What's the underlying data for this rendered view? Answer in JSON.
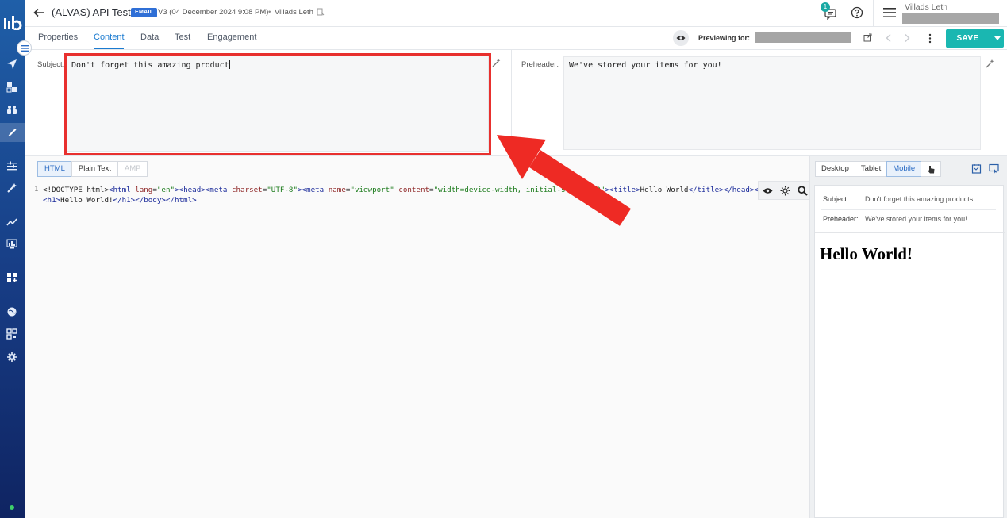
{
  "header": {
    "title": "(ALVAS) API Test",
    "badge": "EMAIL",
    "version": "V3 (04 December 2024 9:08 PM)",
    "separator": "•",
    "version_user": "Villads Leth",
    "notification_count": "1",
    "user_name": "Villads Leth"
  },
  "tabs": [
    {
      "label": "Properties"
    },
    {
      "label": "Content"
    },
    {
      "label": "Data"
    },
    {
      "label": "Test"
    },
    {
      "label": "Engagement"
    }
  ],
  "preview_bar": {
    "label": "Previewing for:",
    "save_label": "SAVE"
  },
  "fields": {
    "subject_label": "Subject:",
    "subject_value": "Don't forget this amazing product",
    "preheader_label": "Preheader:",
    "preheader_value": "We've stored your items for you!"
  },
  "editor": {
    "modes": [
      "HTML",
      "Plain Text",
      "AMP"
    ],
    "active_mode": "HTML",
    "line_number": "1"
  },
  "preview": {
    "devices": [
      "Desktop",
      "Tablet",
      "Mobile"
    ],
    "active_device": "Mobile",
    "subject_label": "Subject:",
    "subject_value": "Don't forget this amazing products",
    "preheader_label": "Preheader:",
    "preheader_value": "We've stored your items for you!",
    "body_heading": "Hello World!"
  },
  "colors": {
    "accent": "#1b7bd0",
    "save": "#1ab7b1",
    "highlight": "#e8302e"
  }
}
